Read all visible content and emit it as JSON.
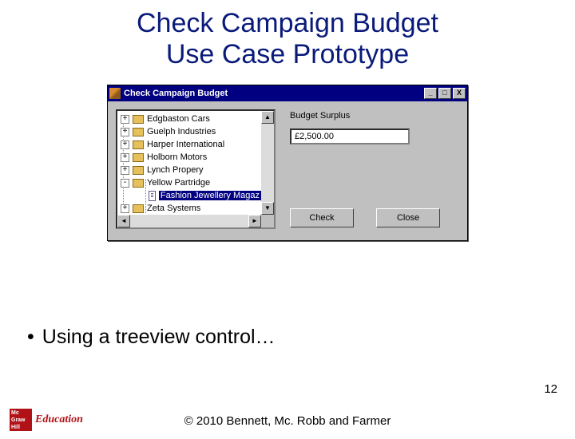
{
  "title_line1": "Check Campaign Budget",
  "title_line2": "Use Case Prototype",
  "window": {
    "title": "Check Campaign Budget",
    "min": "_",
    "max": "□",
    "close": "X"
  },
  "tree": {
    "items": [
      {
        "label": "Edgbaston Cars",
        "exp": "+",
        "type": "folder"
      },
      {
        "label": "Guelph Industries",
        "exp": "+",
        "type": "folder"
      },
      {
        "label": "Harper International",
        "exp": "+",
        "type": "folder"
      },
      {
        "label": "Holborn Motors",
        "exp": "+",
        "type": "folder"
      },
      {
        "label": "Lynch Propery",
        "exp": "+",
        "type": "folder"
      },
      {
        "label": "Yellow Partridge",
        "exp": "-",
        "type": "folder"
      }
    ],
    "child": {
      "label": "Fashion Jewellery Magaz",
      "type": "doc",
      "selected": true
    },
    "last": {
      "label": "Zeta Systems",
      "exp": "+",
      "type": "folder"
    },
    "scroll": {
      "up": "▲",
      "down": "▼",
      "left": "◄",
      "right": "►"
    }
  },
  "field": {
    "label": "Budget Surplus",
    "value": "£2,500.00"
  },
  "buttons": {
    "check": "Check",
    "close": "Close"
  },
  "bullet": "Using a treeview control…",
  "page": "12",
  "copyright": "© 2010 Bennett, Mc. Robb and Farmer",
  "logo": {
    "box_l1": "Mc",
    "box_l2": "Graw",
    "box_l3": "Hill",
    "text": "Education"
  }
}
